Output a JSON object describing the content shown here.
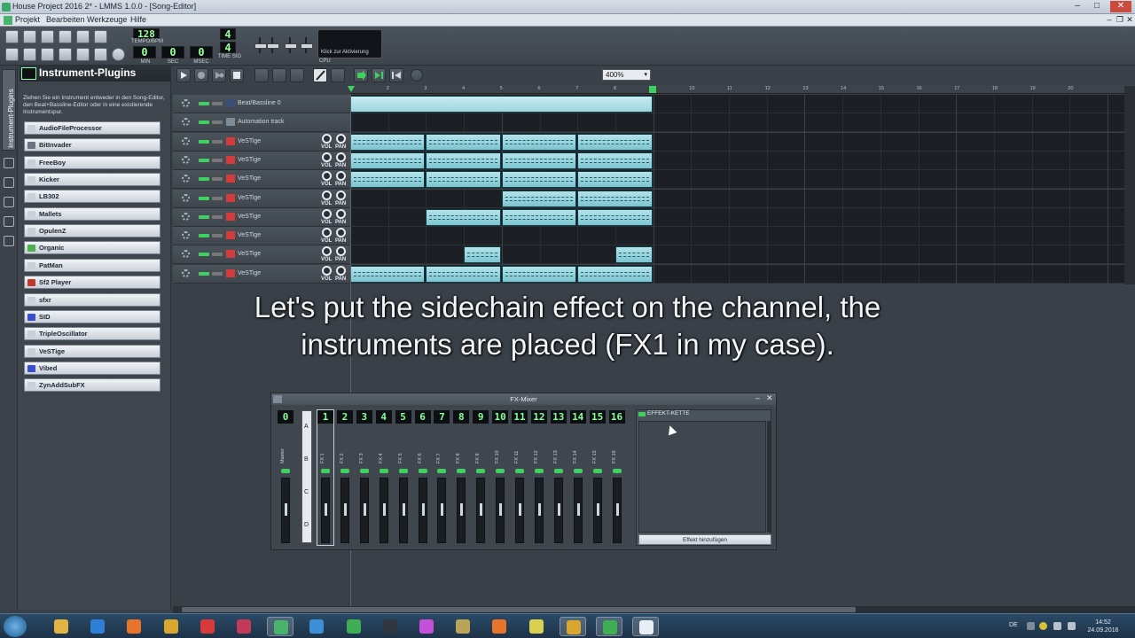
{
  "window": {
    "title": "House Project 2016 2* - LMMS 1.0.0 - [Song-Editor]",
    "controls": [
      "–",
      "□",
      "✕"
    ]
  },
  "menu": {
    "items": [
      "Projekt",
      "Bearbeiten",
      "Werkzeuge",
      "Hilfe"
    ]
  },
  "toolbar": {
    "tempo_value": "128",
    "tempo_caption": "TEMPO/BPM",
    "time_min": "0",
    "time_sec": "0",
    "time_msec": "0",
    "min_caption": "MIN",
    "sec_caption": "SEC",
    "msec_caption": "MSEC",
    "timesig_num": "4",
    "timesig_den": "4",
    "timesig_caption": "TIME SIG",
    "cpu_hint": "Klick zur Aktivierung",
    "cpu_caption": "CPU"
  },
  "side_tab": {
    "label": "Instrument-Plugins"
  },
  "browser": {
    "title": "Instrument-Plugins",
    "description": "Ziehen Sie ein Instrument entweder in den Song-Editor, den Beat+Bassline-Editor oder in eine existierende Instrumentspur.",
    "plugins": [
      {
        "name": "AudioFileProcessor",
        "icon": "audio-file-icon",
        "color": "#c9d0d8"
      },
      {
        "name": "BitInvader",
        "icon": "bitinvader-icon",
        "color": "#6b7480"
      },
      {
        "name": "FreeBoy",
        "icon": "gameboy-icon",
        "color": "#c9d0d8"
      },
      {
        "name": "Kicker",
        "icon": "kicker-icon",
        "color": "#c9d0d8"
      },
      {
        "name": "LB302",
        "icon": "lb302-icon",
        "color": "#c9d0d8"
      },
      {
        "name": "Mallets",
        "icon": "mallets-icon",
        "color": "#c9d0d8"
      },
      {
        "name": "OpulenZ",
        "icon": "opulenz-icon",
        "color": "#c9d0d8"
      },
      {
        "name": "Organic",
        "icon": "organic-icon",
        "color": "#4caf50"
      },
      {
        "name": "PatMan",
        "icon": "patman-icon",
        "color": "#c9d0d8"
      },
      {
        "name": "Sf2 Player",
        "icon": "sf2-icon",
        "color": "#c0392b"
      },
      {
        "name": "sfxr",
        "icon": "sfxr-icon",
        "color": "#c9d0d8"
      },
      {
        "name": "SID",
        "icon": "sid-icon",
        "color": "#3a4fc8"
      },
      {
        "name": "TripleOscillator",
        "icon": "oscillator-icon",
        "color": "#c9d0d8"
      },
      {
        "name": "VeSTige",
        "icon": "vestige-icon",
        "color": "#c9d0d8"
      },
      {
        "name": "Vibed",
        "icon": "vibed-icon",
        "color": "#3a4fc8"
      },
      {
        "name": "ZynAddSubFX",
        "icon": "zyn-icon",
        "color": "#c9d0d8"
      }
    ]
  },
  "song_editor": {
    "zoom": "400%",
    "timeline_marks": [
      "1",
      "2",
      "3",
      "4",
      "5",
      "6",
      "7",
      "8",
      "9",
      "10",
      "11",
      "12",
      "13",
      "14",
      "15",
      "16",
      "17",
      "18",
      "19",
      "20"
    ],
    "tracks": [
      {
        "name": "Beat/Bassline 0",
        "type": "beat-bassline",
        "icon_color": "#3a4f7a",
        "has_knobs": false
      },
      {
        "name": "Automation track",
        "type": "automation",
        "icon_color": "#7f8b96",
        "has_knobs": false
      },
      {
        "name": "VeSTige",
        "type": "instrument",
        "icon_color": "#d43b3b",
        "has_knobs": true
      },
      {
        "name": "VeSTige",
        "type": "instrument",
        "icon_color": "#d43b3b",
        "has_knobs": true
      },
      {
        "name": "VeSTige",
        "type": "instrument",
        "icon_color": "#d43b3b",
        "has_knobs": true
      },
      {
        "name": "VeSTige",
        "type": "instrument",
        "icon_color": "#d43b3b",
        "has_knobs": true
      },
      {
        "name": "VeSTige",
        "type": "instrument",
        "icon_color": "#d43b3b",
        "has_knobs": true
      },
      {
        "name": "VeSTige",
        "type": "instrument",
        "icon_color": "#d43b3b",
        "has_knobs": true
      },
      {
        "name": "VeSTige",
        "type": "instrument",
        "icon_color": "#d43b3b",
        "has_knobs": true
      },
      {
        "name": "VeSTige",
        "type": "instrument",
        "icon_color": "#d43b3b",
        "has_knobs": true
      }
    ],
    "vol_label": "VOL",
    "pan_label": "PAN"
  },
  "subtitle": {
    "line1": "Let's put the sidechain effect on the channel, the",
    "line2": "instruments are placed (FX1 in my case)."
  },
  "fx_mixer": {
    "title": "FX-Mixer",
    "channels": [
      {
        "num": "0",
        "name": "Master"
      },
      {
        "num": "1",
        "name": "FX 1"
      },
      {
        "num": "2",
        "name": "FX 2"
      },
      {
        "num": "3",
        "name": "FX 3"
      },
      {
        "num": "4",
        "name": "FX 4"
      },
      {
        "num": "5",
        "name": "FX 5"
      },
      {
        "num": "6",
        "name": "FX 6"
      },
      {
        "num": "7",
        "name": "FX 7"
      },
      {
        "num": "8",
        "name": "FX 8"
      },
      {
        "num": "9",
        "name": "FX 9"
      },
      {
        "num": "10",
        "name": "FX 10"
      },
      {
        "num": "11",
        "name": "FX 11"
      },
      {
        "num": "12",
        "name": "FX 12"
      },
      {
        "num": "13",
        "name": "FX 13"
      },
      {
        "num": "14",
        "name": "FX 14"
      },
      {
        "num": "15",
        "name": "FX 15"
      },
      {
        "num": "16",
        "name": "FX 16"
      }
    ],
    "banks": [
      "A",
      "B",
      "C",
      "D"
    ],
    "effect_chain_label": "EFFEKT-KETTE",
    "add_effect_label": "Effekt hinzufügen"
  },
  "taskbar": {
    "apps": [
      {
        "name": "explorer",
        "color": "#e3b341"
      },
      {
        "name": "internet-explorer",
        "color": "#2f7fd6"
      },
      {
        "name": "firefox",
        "color": "#e8742c"
      },
      {
        "name": "chrome",
        "color": "#d9a72f"
      },
      {
        "name": "screen-recorder",
        "color": "#d63a3a"
      },
      {
        "name": "app-red",
        "color": "#c23a5a"
      },
      {
        "name": "lmms",
        "color": "#47b36d",
        "active": true
      },
      {
        "name": "app-blue",
        "color": "#3a8fd6"
      },
      {
        "name": "app-green",
        "color": "#3fae52"
      },
      {
        "name": "app-dark",
        "color": "#2f3640"
      },
      {
        "name": "itunes",
        "color": "#c44fd8"
      },
      {
        "name": "app-edit",
        "color": "#b8a55a"
      },
      {
        "name": "vlc",
        "color": "#e8742c"
      },
      {
        "name": "app-check",
        "color": "#d8d050"
      },
      {
        "name": "chrome-2",
        "color": "#d9a72f",
        "active": true
      },
      {
        "name": "camtasia",
        "color": "#3fae52",
        "active": true
      },
      {
        "name": "camtasia-2",
        "color": "#e8eef4",
        "active": true
      }
    ],
    "language": "DE",
    "time": "14:52",
    "date": "24.09.2016"
  }
}
